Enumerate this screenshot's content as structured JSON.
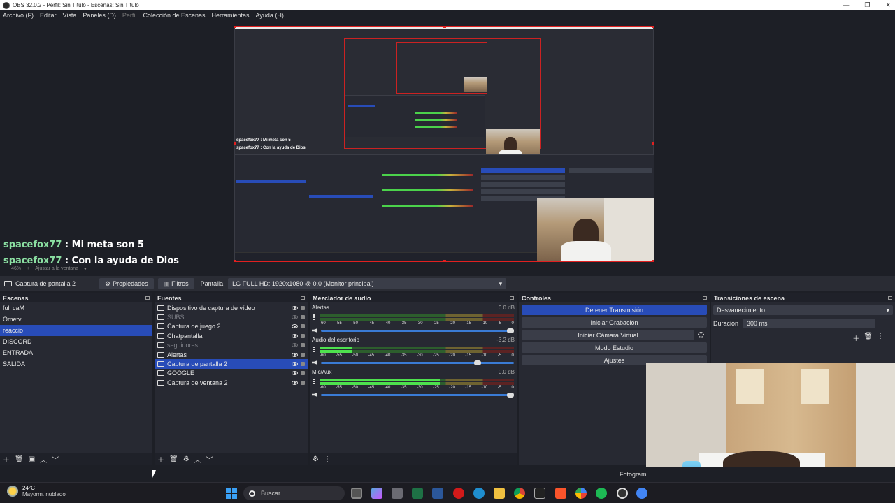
{
  "window": {
    "title": "OBS 32.0.2 - Perfil: Sin Título - Escenas: Sin Título",
    "controls": [
      "—",
      "❐",
      "✕"
    ]
  },
  "menu": [
    {
      "label": "Archivo (F)",
      "enabled": true
    },
    {
      "label": "Editar",
      "enabled": true
    },
    {
      "label": "Vista",
      "enabled": true
    },
    {
      "label": "Paneles (D)",
      "enabled": true
    },
    {
      "label": "Perfil",
      "enabled": false
    },
    {
      "label": "Colección de Escenas",
      "enabled": true
    },
    {
      "label": "Herramientas",
      "enabled": true
    },
    {
      "label": "Ayuda (H)",
      "enabled": true
    }
  ],
  "chat": [
    {
      "user": "spacefox77",
      "text": " : Mi meta son 5"
    },
    {
      "user": "spacefox77",
      "text": " : Con la ayuda de Dios"
    }
  ],
  "preview_zoom": {
    "percent": "46%",
    "fit_label": "Ajustar a la ventana"
  },
  "context_bar": {
    "source_name": "Captura de pantalla 2",
    "properties_label": "Propiedades",
    "filters_label": "Filtros",
    "display_label": "Pantalla",
    "display_value": "LG FULL HD: 1920x1080 @ 0,0 (Monitor principal)"
  },
  "scenes": {
    "title": "Escenas",
    "items": [
      "full caM",
      "Ometv",
      "reaccio",
      "DISCORD",
      "ENTRADA",
      "SALIDA"
    ],
    "active_index": 2
  },
  "sources": {
    "title": "Fuentes",
    "items": [
      {
        "name": "Dispositivo de captura de vídeo",
        "visible": true
      },
      {
        "name": "SUBS",
        "visible": false
      },
      {
        "name": "Captura de juego 2",
        "visible": true
      },
      {
        "name": "Chatpantalla",
        "visible": true
      },
      {
        "name": "seguidores",
        "visible": false
      },
      {
        "name": "Alertas",
        "visible": true
      },
      {
        "name": "Captura de pantalla 2",
        "visible": true,
        "active": true
      },
      {
        "name": "GOOGLE",
        "visible": true
      },
      {
        "name": "Captura de ventana 2",
        "visible": true
      }
    ]
  },
  "mixer": {
    "title": "Mezclador de audio",
    "scale": [
      "-60",
      "-55",
      "-50",
      "-45",
      "-40",
      "-35",
      "-30",
      "-25",
      "-20",
      "-15",
      "-10",
      "-5",
      "0"
    ],
    "channels": [
      {
        "name": "Alertas",
        "db": "0.0 dB",
        "level": 0.0,
        "volume": 1.0
      },
      {
        "name": "Audio del escritorio",
        "db": "-3.2 dB",
        "level": 0.17,
        "volume": 0.83
      },
      {
        "name": "Mic/Aux",
        "db": "0.0 dB",
        "level": 0.62,
        "volume": 1.0
      }
    ]
  },
  "controls": {
    "title": "Controles",
    "buttons": [
      {
        "label": "Detener Transmisión",
        "primary": true
      },
      {
        "label": "Iniciar Grabación",
        "primary": false
      },
      {
        "label": "Iniciar Cámara Virtual",
        "primary": false,
        "gear": true
      },
      {
        "label": "Modo Estudio",
        "primary": false
      },
      {
        "label": "Ajustes",
        "primary": false
      }
    ]
  },
  "transitions": {
    "title": "Transiciones de escena",
    "selected": "Desvanecimiento",
    "duration_label": "Duración",
    "duration_value": "300 ms"
  },
  "status": {
    "fps_label": "Fotogram"
  },
  "taskbar": {
    "weather_temp": "24°C",
    "weather_desc": "Mayorm. nublado",
    "search_placeholder": "Buscar"
  },
  "nested_chat": [
    "spacefox77 : Mi meta son 5",
    "spacefox77 : Con la ayuda de Dios"
  ],
  "colors": {
    "accent": "#284cb8",
    "preview_border": "#e12020",
    "chat_user": "#8be0a2"
  }
}
